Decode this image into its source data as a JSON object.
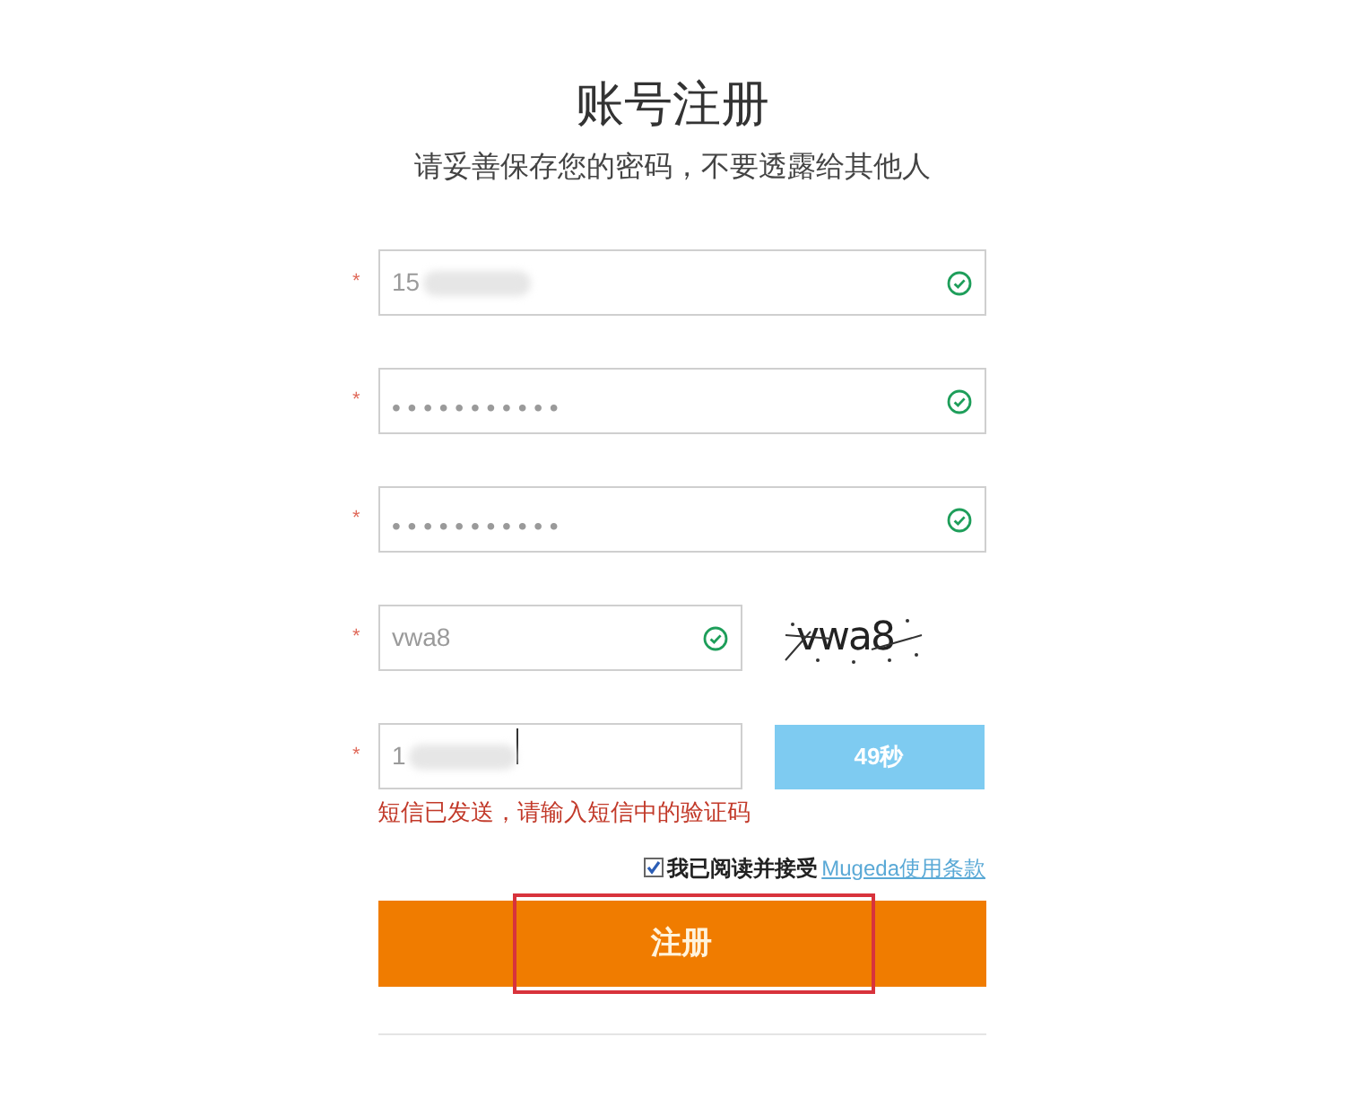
{
  "title": "账号注册",
  "subtitle": "请妥善保存您的密码，不要透露给其他人",
  "fields": [
    {
      "kind": "text",
      "required_mark": "*",
      "value": "15",
      "redacted": true,
      "valid": true
    },
    {
      "kind": "password",
      "required_mark": "*",
      "value": "• • • • • • • • • • •",
      "valid": true
    },
    {
      "kind": "password",
      "required_mark": "*",
      "value": "• • • • • • • • • • •",
      "valid": true
    },
    {
      "kind": "captcha",
      "required_mark": "*",
      "value": "vwa8",
      "captcha_text": "vwa8",
      "valid": true
    },
    {
      "kind": "sms",
      "required_mark": "*",
      "value": "1",
      "redacted": true,
      "valid": false,
      "countdown": "49秒",
      "message": "短信已发送，请输入短信中的验证码"
    }
  ],
  "agreement": {
    "checked": true,
    "text": "我已阅读并接受",
    "link": "Mugeda使用条款"
  },
  "submit": {
    "label": "注册",
    "highlighted": true
  }
}
